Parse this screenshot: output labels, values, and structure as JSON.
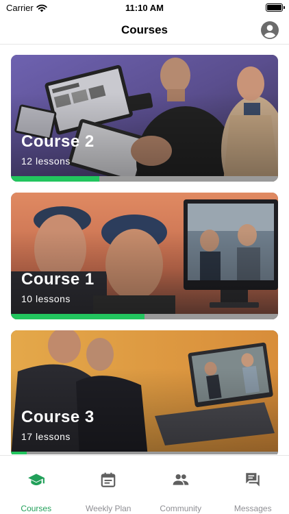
{
  "status_bar": {
    "carrier": "Carrier",
    "time": "11:10 AM"
  },
  "header": {
    "title": "Courses",
    "profile_icon": "account-circle-icon"
  },
  "courses": [
    {
      "title": "Course 2",
      "lessons": "12 lessons",
      "progress": 0.33
    },
    {
      "title": "Course 1",
      "lessons": "10 lessons",
      "progress": 0.5
    },
    {
      "title": "Course 3",
      "lessons": "17 lessons",
      "progress": 0.06
    }
  ],
  "tabs": [
    {
      "label": "Courses",
      "icon": "graduation-cap-icon",
      "active": true
    },
    {
      "label": "Weekly Plan",
      "icon": "calendar-icon",
      "active": false
    },
    {
      "label": "Community",
      "icon": "people-icon",
      "active": false
    },
    {
      "label": "Messages",
      "icon": "chat-icon",
      "active": false
    }
  ],
  "colors": {
    "accent": "#22c55e",
    "tab_active": "#22a05a",
    "tab_inactive": "#8e8e93"
  }
}
